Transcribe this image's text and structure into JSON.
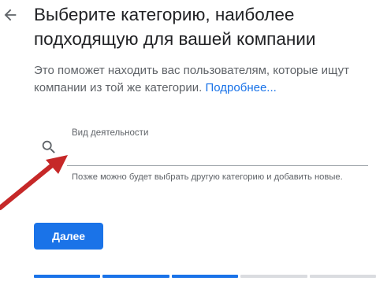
{
  "header": {
    "back_icon": "arrow-back-icon",
    "title": "Выберите категорию, наиболее подходящую для вашей компании"
  },
  "intro": {
    "text": "Это поможет находить вас пользователям, которые ищут компании из той же категории. ",
    "link": "Подробнее..."
  },
  "category_field": {
    "icon": "search-icon",
    "label": "Вид деятельности",
    "value": "",
    "hint": "Позже можно будет выбрать другую категорию и добавить новые."
  },
  "actions": {
    "next_label": "Далее"
  },
  "progress": {
    "total_steps": 5,
    "completed_steps": 3,
    "active_color": "#1a73e8",
    "inactive_color": "#dadce0"
  },
  "colors": {
    "accent": "#1a73e8",
    "annotation_arrow": "#c62828"
  }
}
